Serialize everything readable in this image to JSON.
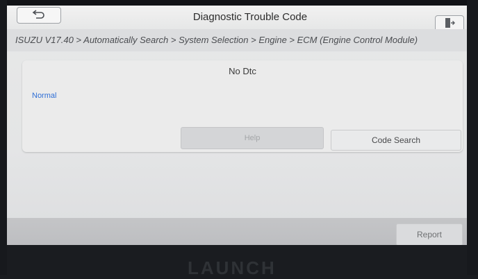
{
  "header": {
    "title": "Diagnostic Trouble Code",
    "back_icon": "back-arrow-icon",
    "exit_icon": "exit-door-icon"
  },
  "breadcrumb": "ISUZU V17.40 > Automatically Search > System Selection > Engine > ECM (Engine Control Module)",
  "result": {
    "message": "No Dtc",
    "status": "Normal",
    "status_color": "#2f6fd6"
  },
  "buttons": {
    "help": "Help",
    "code_search": "Code Search",
    "report": "Report"
  },
  "device": {
    "brand": "LAUNCH"
  }
}
